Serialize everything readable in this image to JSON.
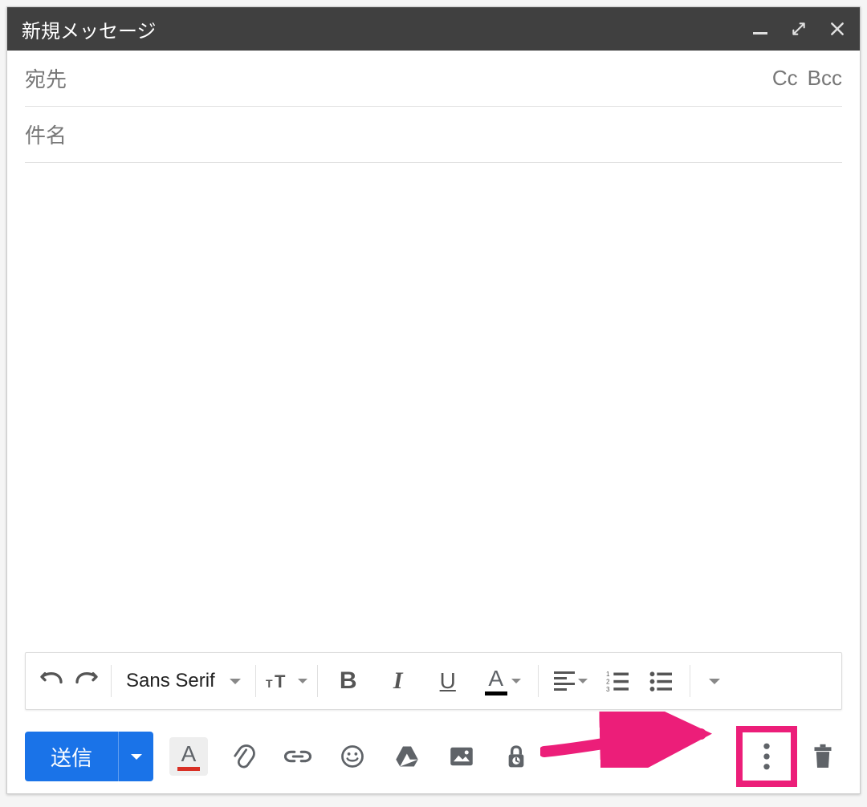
{
  "window": {
    "title": "新規メッセージ",
    "minimize_icon": "minimize",
    "fullscreen_icon": "fullscreen",
    "close_icon": "close"
  },
  "fields": {
    "to_label": "宛先",
    "cc_label": "Cc",
    "bcc_label": "Bcc",
    "subject_label": "件名"
  },
  "format_toolbar": {
    "undo_icon": "undo",
    "redo_icon": "redo",
    "font_name": "Sans Serif",
    "font_size_icon": "font-size",
    "bold_label": "B",
    "italic_label": "I",
    "underline_label": "U",
    "text_color_label": "A",
    "align_icon": "align-left",
    "numbered_list_icon": "numbered-list",
    "bulleted_list_icon": "bulleted-list",
    "more_formatting_icon": "more-formatting"
  },
  "bottom_bar": {
    "send_label": "送信",
    "formatting_toggle_label": "A",
    "attach_icon": "paperclip",
    "link_icon": "link",
    "emoji_icon": "emoji",
    "drive_icon": "google-drive",
    "image_icon": "image",
    "confidential_icon": "confidential-mode",
    "more_options_icon": "more-vertical",
    "discard_icon": "trash"
  },
  "annotation": {
    "type": "arrow-highlight",
    "color": "#ec1e79",
    "target": "more-options-button"
  }
}
